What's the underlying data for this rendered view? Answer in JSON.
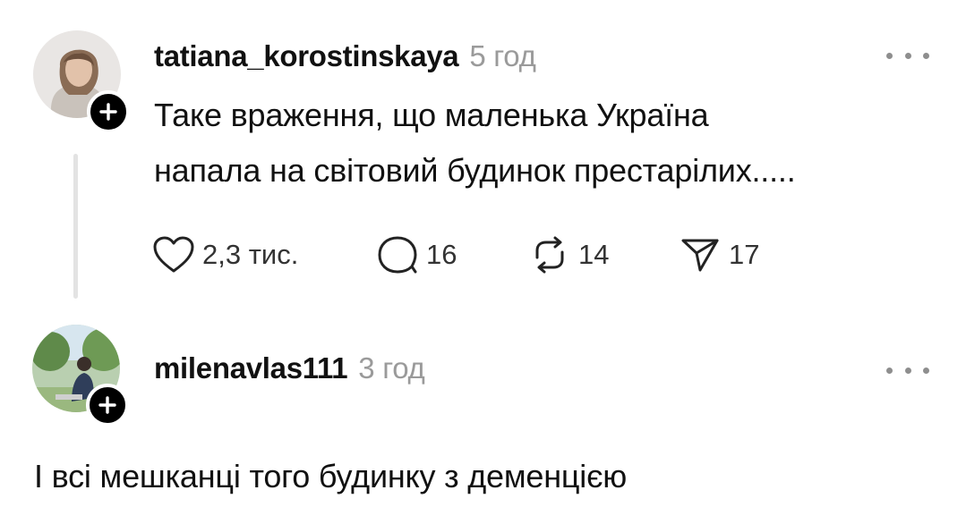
{
  "posts": [
    {
      "username": "tatiana_korostinskaya",
      "time": "5 год",
      "text_lines": [
        "Таке враження, що маленька Україна",
        "напала на світовий будинок престарілих....."
      ],
      "likes": "2,3 тис.",
      "replies": "16",
      "reposts": "14",
      "shares": "17"
    },
    {
      "username": "milenavlas111",
      "time": "3 год",
      "text_lines": [
        "І всі мешканці того будинку з деменцією"
      ]
    }
  ],
  "colors": {
    "text": "#111111",
    "muted": "#9a9a9a",
    "thread_line": "#e3e3e3"
  },
  "icons": [
    "plus-icon",
    "more-icon",
    "heart-icon",
    "comment-icon",
    "repost-icon",
    "share-icon"
  ]
}
